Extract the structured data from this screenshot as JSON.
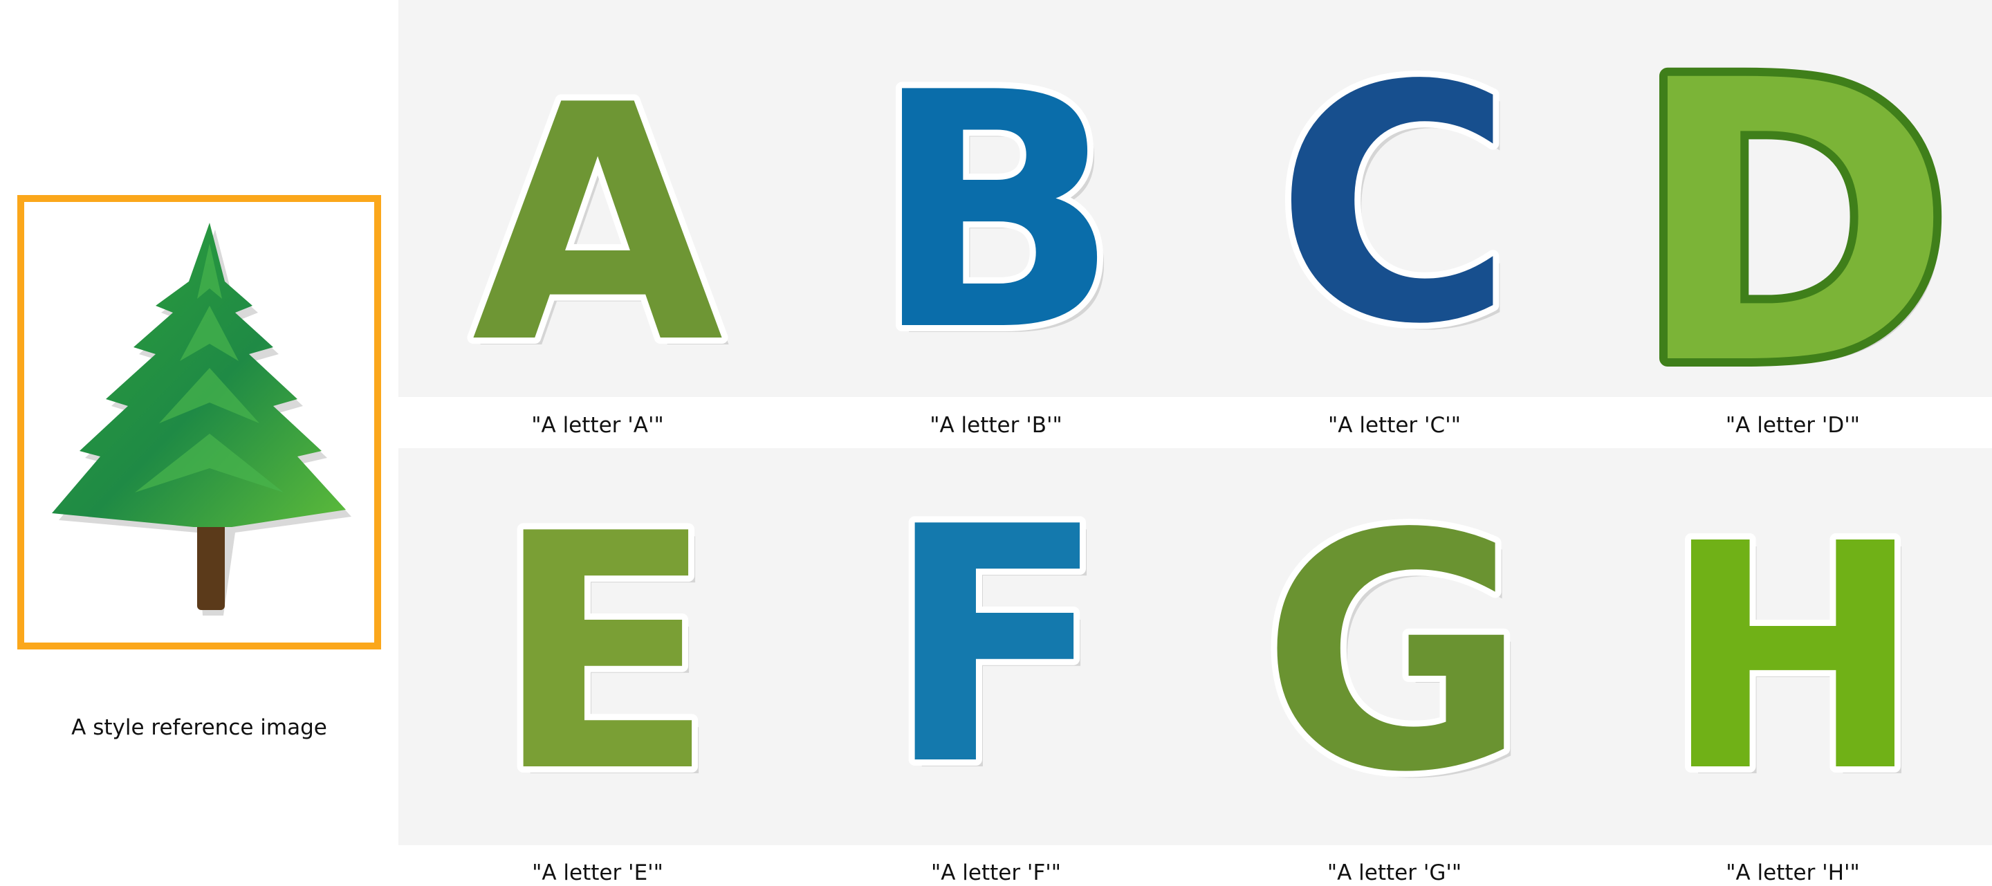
{
  "reference": {
    "caption": "A style reference image",
    "frame_color": "#FBA71B",
    "icon": "pine-tree-sticker"
  },
  "letters": [
    {
      "letter": "A",
      "caption": "\"A letter 'A'\"",
      "color": "#6E9634",
      "dark": "#5a7e27"
    },
    {
      "letter": "B",
      "caption": "\"A letter 'B'\"",
      "color": "#0A6DAA",
      "dark": "#073f6b"
    },
    {
      "letter": "C",
      "caption": "\"A letter 'C'\"",
      "color": "#174F8E",
      "dark": "#123e72"
    },
    {
      "letter": "D",
      "caption": "\"A letter 'D'\"",
      "color": "#7BB437",
      "dark": "#3F7F1A"
    },
    {
      "letter": "E",
      "caption": "\"A letter 'E'\"",
      "color": "#7A9F35",
      "dark": "#637f2a"
    },
    {
      "letter": "F",
      "caption": "\"A letter 'F'\"",
      "color": "#1479AD",
      "dark": "#0f5d86"
    },
    {
      "letter": "G",
      "caption": "\"A letter 'G'\"",
      "color": "#6A9331",
      "dark": "#557a25"
    },
    {
      "letter": "H",
      "caption": "\"A letter 'H'\"",
      "color": "#70B117",
      "dark": "#5a9410"
    }
  ]
}
